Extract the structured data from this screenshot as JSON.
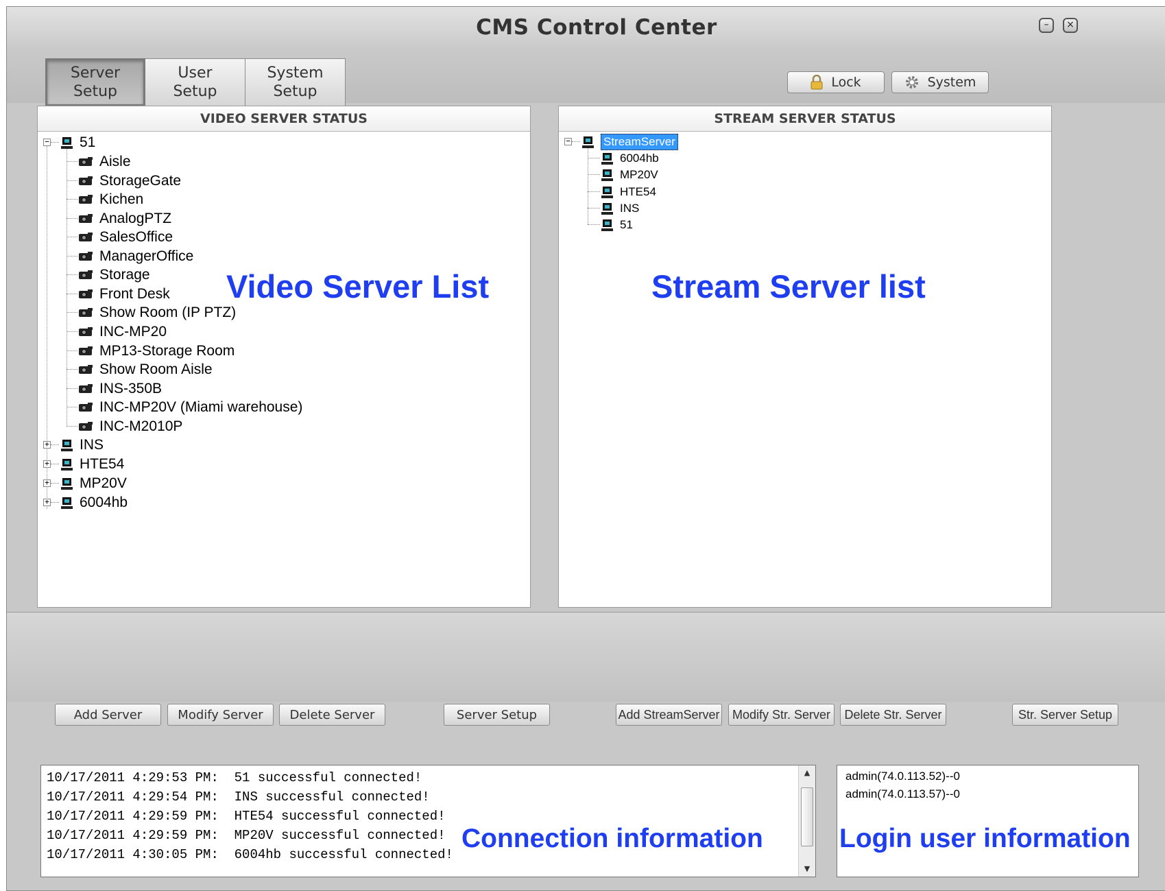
{
  "window": {
    "title": "CMS Control Center"
  },
  "tabs": [
    {
      "label": "Server\nSetup",
      "active": true
    },
    {
      "label": "User\nSetup",
      "active": false
    },
    {
      "label": "System\nSetup",
      "active": false
    }
  ],
  "top_buttons": {
    "lock_label": "Lock",
    "system_label": "System"
  },
  "video_panel": {
    "title": "VIDEO SERVER STATUS",
    "root": "51",
    "cameras": [
      "Aisle",
      "StorageGate",
      "Kichen",
      "AnalogPTZ",
      "SalesOffice",
      "ManagerOffice",
      "Storage",
      "Front Desk",
      "Show Room (IP PTZ)",
      "INC-MP20",
      "MP13-Storage Room",
      "Show Room Aisle",
      "INS-350B",
      "INC-MP20V (Miami warehouse)",
      "INC-M2010P"
    ],
    "collapsed_servers": [
      "INS",
      "HTE54",
      "MP20V",
      "6004hb"
    ]
  },
  "stream_panel": {
    "title": "STREAM SERVER STATUS",
    "root": "StreamServer",
    "servers": [
      "6004hb",
      "MP20V",
      "HTE54",
      "INS",
      "51"
    ]
  },
  "annotations": {
    "video_list": "Video Server List",
    "stream_list": "Stream Server list",
    "connection": "Connection information",
    "login": "Login user information"
  },
  "bottom_buttons": {
    "add_server": "Add Server",
    "modify_server": "Modify Server",
    "delete_server": "Delete Server",
    "server_setup": "Server Setup",
    "add_stream": "Add StreamServer",
    "modify_stream": "Modify Str. Server",
    "delete_stream": "Delete Str. Server",
    "stream_setup": "Str. Server Setup"
  },
  "log": [
    "10/17/2011 4:29:53 PM:  51 successful connected!",
    "10/17/2011 4:29:54 PM:  INS successful connected!",
    "10/17/2011 4:29:59 PM:  HTE54 successful connected!",
    "10/17/2011 4:29:59 PM:  MP20V successful connected!",
    "10/17/2011 4:30:05 PM:  6004hb successful connected!"
  ],
  "login_users": [
    "admin(74.0.113.52)--0",
    "admin(74.0.113.57)--0"
  ],
  "colors": {
    "annotation": "#1e3ef0",
    "selection": "#3399ff"
  }
}
